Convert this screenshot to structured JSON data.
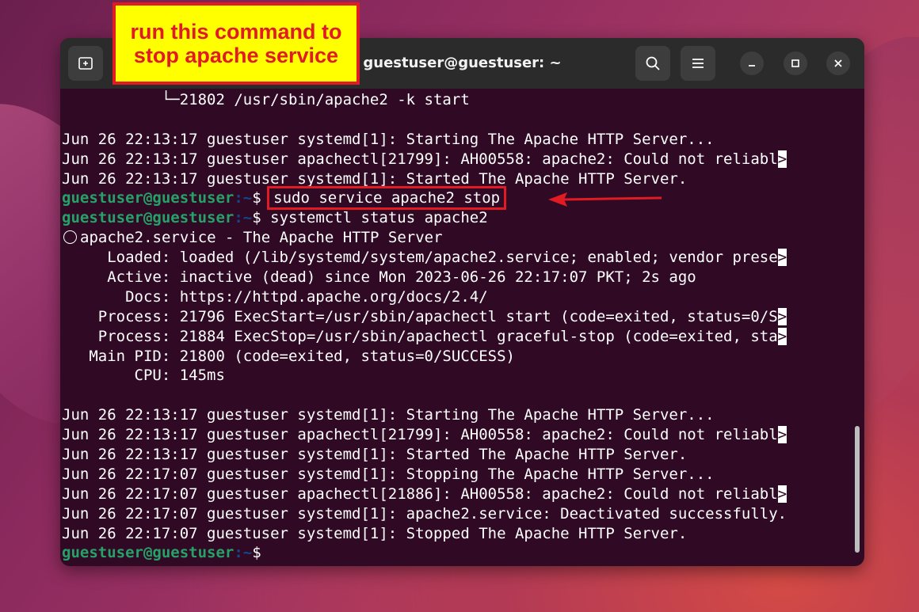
{
  "window": {
    "title": "guestuser@guestuser: ~",
    "buttons": {
      "new_tab_icon": "new-tab-icon",
      "search_icon": "search-icon",
      "menu_icon": "hamburger-menu-icon",
      "minimize_icon": "minimize-icon",
      "maximize_icon": "maximize-icon",
      "close_icon": "close-icon"
    }
  },
  "annotation": {
    "callout_line1": "run this command to",
    "callout_line2": "stop apache service",
    "color": "#e01b24",
    "background": "#ffff00"
  },
  "prompt": {
    "user": "guestuser@guestuser",
    "path": ":~",
    "symbol": "$"
  },
  "terminal": {
    "lines": [
      {
        "type": "text",
        "text": "           └─21802 /usr/sbin/apache2 -k start"
      },
      {
        "type": "text",
        "text": ""
      },
      {
        "type": "text",
        "text": "Jun 26 22:13:17 guestuser systemd[1]: Starting The Apache HTTP Server..."
      },
      {
        "type": "trunc",
        "text": "Jun 26 22:13:17 guestuser apachectl[21799]: AH00558: apache2: Could not reliabl",
        "mark": ">"
      },
      {
        "type": "text",
        "text": "Jun 26 22:13:17 guestuser systemd[1]: Started The Apache HTTP Server."
      },
      {
        "type": "prompt",
        "command": "sudo service apache2 stop",
        "highlight": true
      },
      {
        "type": "prompt",
        "command": "systemctl status apache2"
      },
      {
        "type": "service",
        "text": "apache2.service - The Apache HTTP Server"
      },
      {
        "type": "trunc",
        "text": "     Loaded: loaded (/lib/systemd/system/apache2.service; enabled; vendor prese",
        "mark": ">"
      },
      {
        "type": "text",
        "text": "     Active: inactive (dead) since Mon 2023-06-26 22:17:07 PKT; 2s ago"
      },
      {
        "type": "text",
        "text": "       Docs: https://httpd.apache.org/docs/2.4/"
      },
      {
        "type": "trunc",
        "text": "    Process: 21796 ExecStart=/usr/sbin/apachectl start (code=exited, status=0/S",
        "mark": ">"
      },
      {
        "type": "trunc",
        "text": "    Process: 21884 ExecStop=/usr/sbin/apachectl graceful-stop (code=exited, sta",
        "mark": ">"
      },
      {
        "type": "text",
        "text": "   Main PID: 21800 (code=exited, status=0/SUCCESS)"
      },
      {
        "type": "text",
        "text": "        CPU: 145ms"
      },
      {
        "type": "text",
        "text": ""
      },
      {
        "type": "text",
        "text": "Jun 26 22:13:17 guestuser systemd[1]: Starting The Apache HTTP Server..."
      },
      {
        "type": "trunc",
        "text": "Jun 26 22:13:17 guestuser apachectl[21799]: AH00558: apache2: Could not reliabl",
        "mark": ">"
      },
      {
        "type": "text",
        "text": "Jun 26 22:13:17 guestuser systemd[1]: Started The Apache HTTP Server."
      },
      {
        "type": "text",
        "text": "Jun 26 22:17:07 guestuser systemd[1]: Stopping The Apache HTTP Server..."
      },
      {
        "type": "trunc",
        "text": "Jun 26 22:17:07 guestuser apachectl[21886]: AH00558: apache2: Could not reliabl",
        "mark": ">"
      },
      {
        "type": "text",
        "text": "Jun 26 22:17:07 guestuser systemd[1]: apache2.service: Deactivated successfully."
      },
      {
        "type": "text",
        "text": "Jun 26 22:17:07 guestuser systemd[1]: Stopped The Apache HTTP Server."
      },
      {
        "type": "prompt",
        "command": ""
      }
    ]
  },
  "colors": {
    "terminal_bg": "#300a24",
    "titlebar_bg": "#2b2b2b",
    "prompt_user": "#26a269",
    "prompt_path": "#12488b"
  }
}
